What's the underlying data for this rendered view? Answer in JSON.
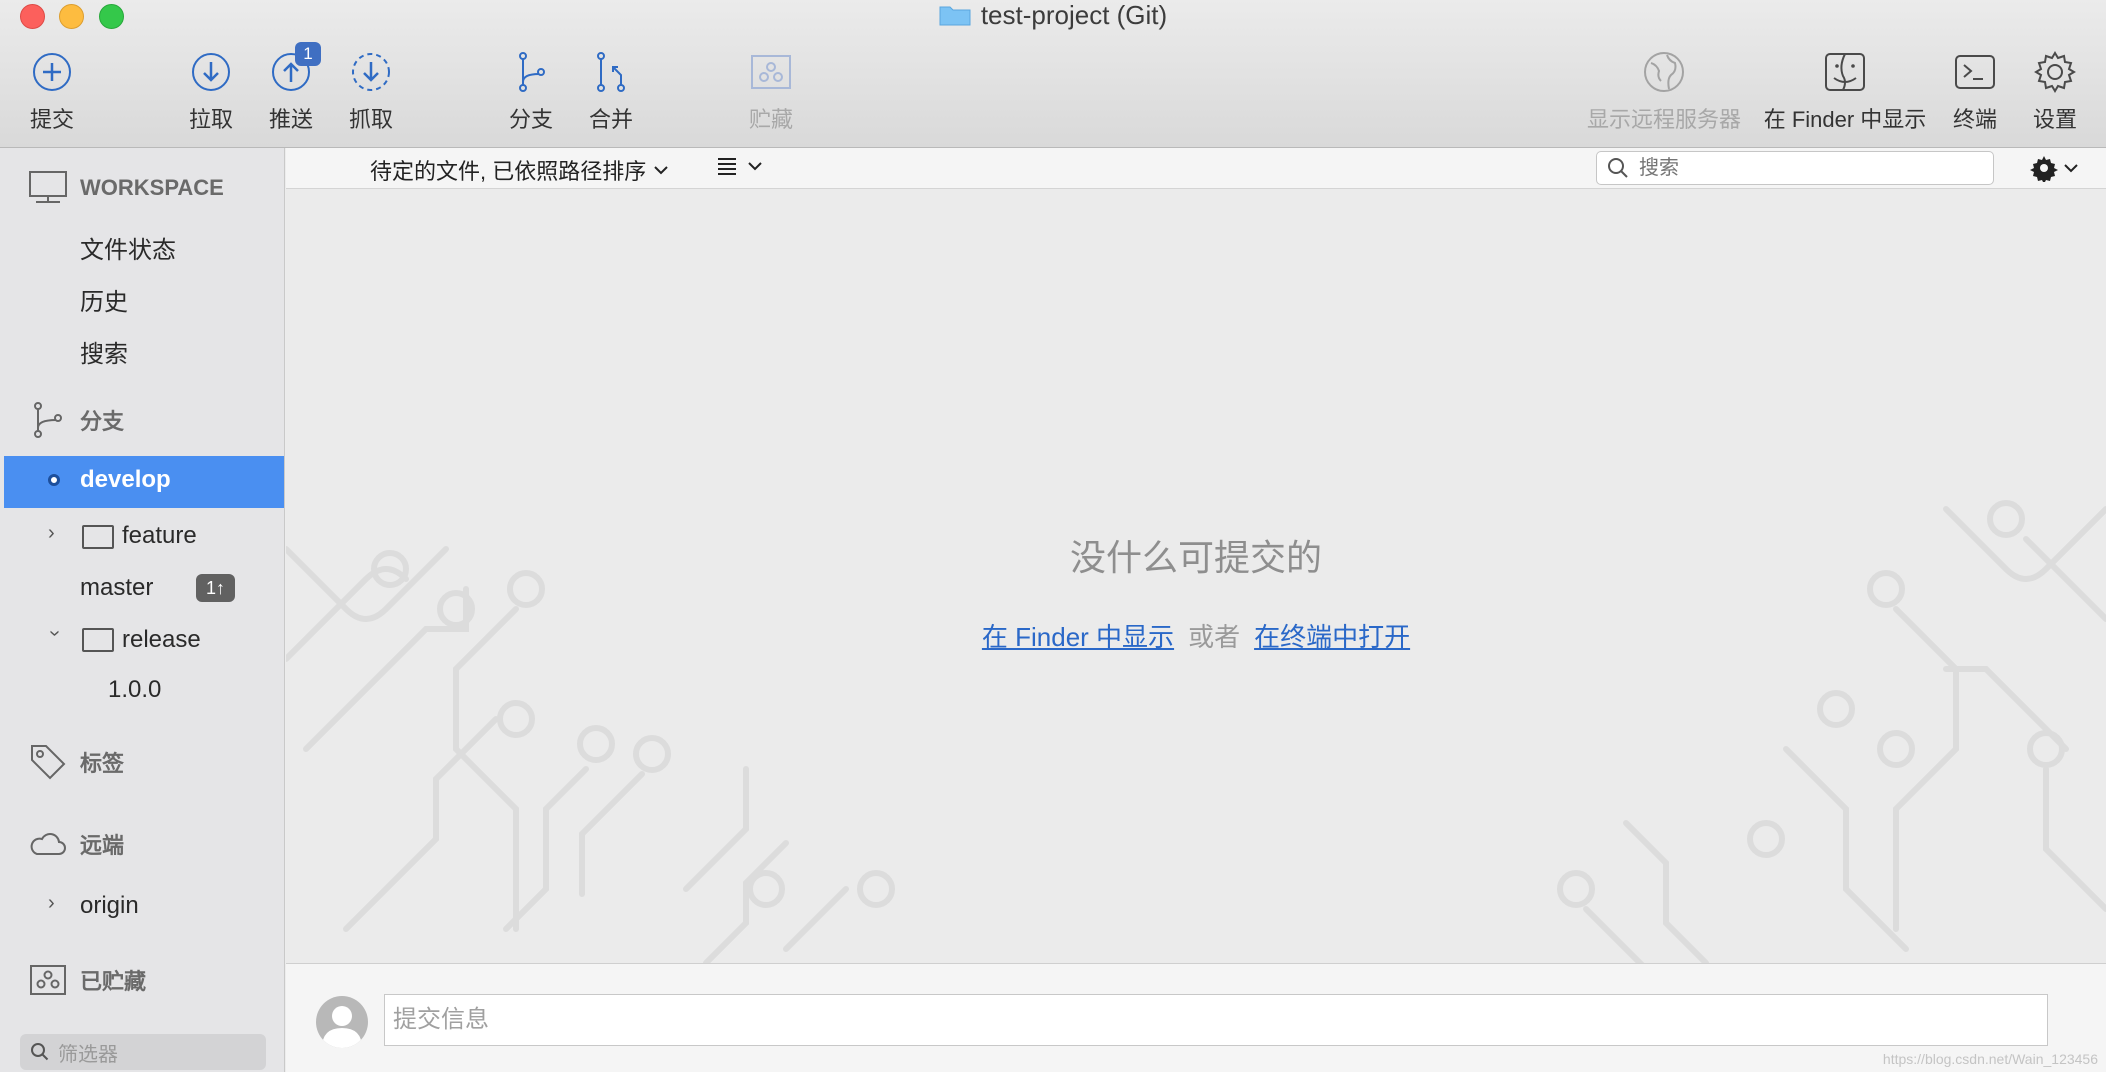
{
  "window": {
    "title": "test-project (Git)"
  },
  "toolbar": {
    "commit": "提交",
    "pull": "拉取",
    "push": "推送",
    "push_badge": "1",
    "fetch": "抓取",
    "branch": "分支",
    "merge": "合并",
    "stash": "贮藏",
    "show_remote": "显示远程服务器",
    "show_in_finder": "在 Finder 中显示",
    "terminal": "终端",
    "settings": "设置"
  },
  "sidebar": {
    "workspace": {
      "header": "WORKSPACE",
      "items": [
        "文件状态",
        "历史",
        "搜索"
      ]
    },
    "branches": {
      "header": "分支",
      "current": "develop",
      "folder_feature": "feature",
      "master": "master",
      "master_count": "1↑",
      "folder_release": "release",
      "release_child": "1.0.0"
    },
    "tags": {
      "header": "标签"
    },
    "remotes": {
      "header": "远端",
      "origin": "origin"
    },
    "stashes": {
      "header": "已贮藏"
    },
    "filter_placeholder": "筛选器"
  },
  "mainbar": {
    "sort_label": "待定的文件, 已依照路径排序",
    "search_placeholder": "搜索"
  },
  "content": {
    "empty_title": "没什么可提交的",
    "link_finder": "在 Finder 中显示",
    "or": "或者",
    "link_terminal": "在终端中打开"
  },
  "commit": {
    "placeholder": "提交信息"
  },
  "watermark": "https://blog.csdn.net/Wain_123456"
}
